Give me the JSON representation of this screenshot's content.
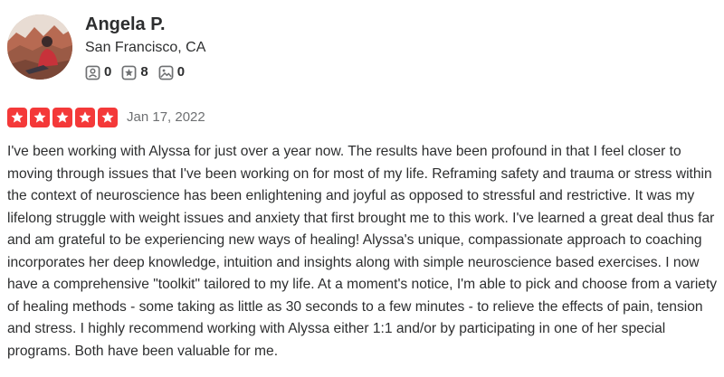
{
  "user": {
    "name": "Angela P.",
    "location": "San Francisco, CA",
    "stats": {
      "friends": "0",
      "reviews": "8",
      "photos": "0"
    }
  },
  "review": {
    "rating": 5,
    "rating_max": 5,
    "star_color": "#f43939",
    "date": "Jan 17, 2022",
    "text": "I've been working with Alyssa for just over a year now. The results have been profound in that I feel closer to moving through issues that I've been working on for most of my life. Reframing safety and trauma or stress within the context of neuroscience has been enlightening and joyful as opposed to stressful and restrictive. It was my lifelong struggle with weight issues and anxiety that first brought me to this work. I've learned a great deal thus far and am grateful to be experiencing new ways of healing! Alyssa's unique, compassionate approach to coaching incorporates her deep knowledge, intuition and insights along with simple neuroscience based exercises. I now have a comprehensive \"toolkit\" tailored to my life. At a moment's notice, I'm able to pick and choose from a variety of healing methods - some taking as little as 30 seconds to a few minutes - to relieve the effects of pain, tension and stress. I highly recommend working with Alyssa either 1:1 and/or by participating in one of her special programs. Both have been valuable for me."
  },
  "icons": {
    "friends": "friends-icon",
    "reviews": "review-star-icon",
    "photos": "photo-icon",
    "star": "star-icon"
  }
}
